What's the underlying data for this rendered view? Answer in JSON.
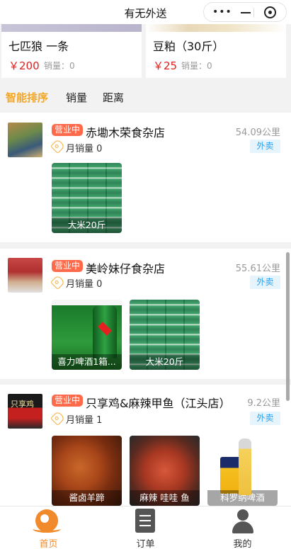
{
  "titlebar": {
    "title": "有无外送",
    "more_icon": "more-dots-icon",
    "minimize_icon": "minimize-icon",
    "close_icon": "target-circle-icon"
  },
  "top_products": [
    {
      "name": "七匹狼 一条",
      "price": "￥200",
      "sales": "销量：0"
    },
    {
      "name": "豆粕（30斤）",
      "price": "￥25",
      "sales": "销量：0"
    }
  ],
  "sort": {
    "items": [
      "智能排序",
      "销量",
      "距离"
    ],
    "active": "智能排序"
  },
  "shops": [
    {
      "status": "营业中",
      "name": "赤墈木荣食杂店",
      "distance": "54.09公里",
      "monthly_sales": "月销量 0",
      "delivery": "外卖",
      "goods": [
        {
          "label": "大米20斤"
        }
      ]
    },
    {
      "status": "营业中",
      "name": "美岭妹仔食杂店",
      "distance": "55.61公里",
      "monthly_sales": "月销量 0",
      "delivery": "外卖",
      "goods": [
        {
          "label": "喜力啤酒1箱..."
        },
        {
          "label": "大米20斤"
        }
      ]
    },
    {
      "status": "营业中",
      "name": "只享鸡&麻辣甲鱼（江头店）",
      "distance": "9.2公里",
      "monthly_sales": "月销量 1",
      "delivery": "外卖",
      "goods": [
        {
          "label": "酱卤羊蹄"
        },
        {
          "label": "麻辣 哇哇 鱼"
        },
        {
          "label": "科罗纳啤酒"
        }
      ]
    }
  ],
  "tabbar": {
    "items": [
      {
        "label": "首页",
        "icon": "home-icon"
      },
      {
        "label": "订单",
        "icon": "order-list-icon"
      },
      {
        "label": "我的",
        "icon": "user-icon"
      }
    ],
    "active": "首页"
  },
  "colors": {
    "accent": "#f08a2a",
    "price": "#e02020",
    "badge": "#ff6b4a",
    "delivery_bg": "#e6f4fd",
    "delivery_text": "#2a9ef0",
    "sort_active": "#f5a623"
  }
}
